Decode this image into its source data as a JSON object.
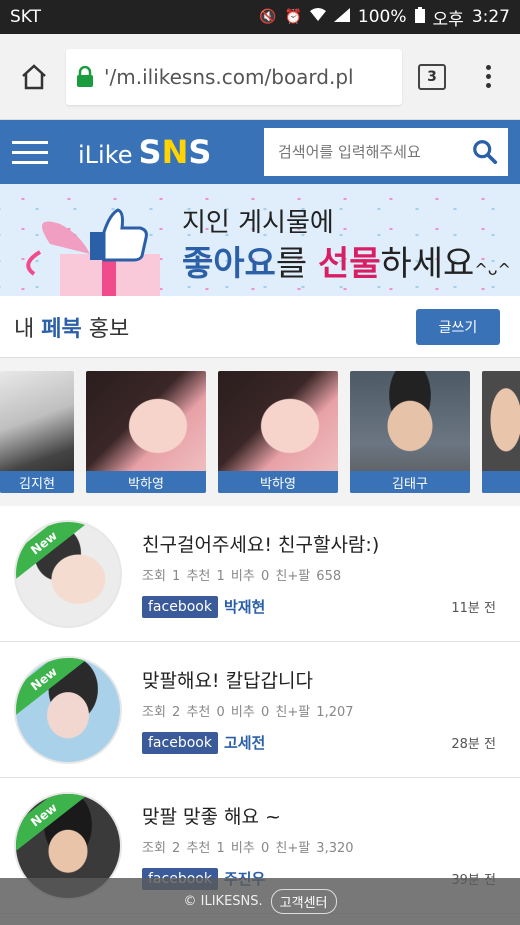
{
  "status_bar": {
    "carrier": "SKT",
    "battery": "100%",
    "ampm": "오후",
    "time": "3:27"
  },
  "browser": {
    "url": "'/m.ilikesns.com/board.pl",
    "tab_count": "3"
  },
  "site_header": {
    "logo_prefix": "iLike",
    "logo_s1": "S",
    "logo_n": "N",
    "logo_s2": "S",
    "search_placeholder": "검색어를 입력해주세요"
  },
  "banner": {
    "line1": "지인 게시물에",
    "line2_a": "좋아요",
    "line2_b": "를 ",
    "line2_c": "선물",
    "line2_d": "하세요",
    "line2_e": "^ᴗ^"
  },
  "section": {
    "title_a": "내 ",
    "title_b": "페북",
    "title_c": " 홍보",
    "write_button": "글쓰기"
  },
  "promo_cards": [
    {
      "name": "김지현"
    },
    {
      "name": "박하영"
    },
    {
      "name": "박하영"
    },
    {
      "name": "김태구"
    },
    {
      "name": ""
    }
  ],
  "posts": [
    {
      "badge": "New",
      "title": "친구걸어주세요! 친구할사람:)",
      "stats": "조회 1   추천 1   비추 0   친+팔 658",
      "source": "facebook",
      "author": "박재현",
      "time": "11분 전"
    },
    {
      "badge": "New",
      "title": "맞팔해요! 칼답갑니다",
      "stats": "조회 2   추천 0   비추 0   친+팔 1,207",
      "source": "facebook",
      "author": "고세전",
      "time": "28분 전"
    },
    {
      "badge": "New",
      "title": "맞팔 맞좋 해요 ~",
      "stats": "조회 2   추천 1   비추 0   친+팔 3,320",
      "source": "facebook",
      "author": "주진우",
      "time": "39분 전"
    }
  ],
  "footer": {
    "copyright": "© ILIKESNS.",
    "customer_center": "고객센터"
  },
  "colors": {
    "brand_blue": "#3a72b8",
    "facebook_badge": "#3a5a9a",
    "new_green": "#3cb44b",
    "accent_yellow": "#ffd400",
    "accent_pink": "#d81e64"
  }
}
